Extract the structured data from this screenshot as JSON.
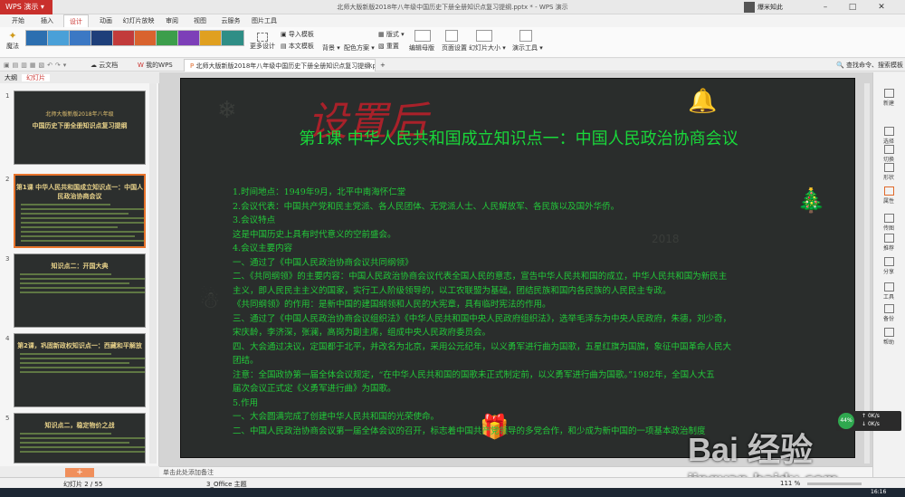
{
  "titlebar": {
    "app_name": "WPS 演示",
    "window_title": "北师大版新版2018年八年级中国历史下册全册知识点复习提纲.pptx * - WPS 演示",
    "user_name": "爆米知此"
  },
  "menu_tabs": [
    "开始",
    "插入",
    "设计",
    "动画",
    "幻灯片放映",
    "审阅",
    "视图",
    "云服务",
    "图片工具"
  ],
  "ribbon": {
    "magic": "魔法",
    "more_design": "更多设计",
    "import_template": "导入模板",
    "text_template": "本文模板",
    "background": "背景",
    "color_scheme": "配色方案",
    "layout": "版式",
    "reset": "重置",
    "edit_master": "编辑母版",
    "page_setup": "页面设置",
    "slide_size": "幻灯片大小",
    "presentation_tools": "演示工具",
    "theme_colors": [
      "#2c6fb0",
      "#4aa0d8",
      "#3b78c4",
      "#1e3f7a",
      "#c23b3b",
      "#d9632e",
      "#3c9e4b",
      "#7d3fb8",
      "#e0a020",
      "#2f8e86"
    ]
  },
  "quickbar": {
    "cloud": "云文档",
    "my_wps": "我的WPS",
    "doc_tab": "北师大版新版2018年八年级中国历史下册全册知识点复习提纲.pptx",
    "search_placeholder": "查找命令、搜索模板"
  },
  "left_panel": {
    "tab_outline": "大纲",
    "tab_slides": "幻灯片",
    "add_button": "+",
    "thumbs": [
      {
        "num": "1",
        "line1": "北师大版新版2018年八年级",
        "line2": "中国历史下册全册知识点复习提纲"
      },
      {
        "num": "2",
        "line1": "第1课 中华人民共和国成立知识点一：中国人民政治协商会议",
        "line2": ""
      },
      {
        "num": "3",
        "line1": "知识点二：开国大典",
        "line2": ""
      },
      {
        "num": "4",
        "line1": "第2课，巩固新政权知识点一：西藏和平解放",
        "line2": ""
      },
      {
        "num": "5",
        "line1": "知识点二，稳定物价之战",
        "line2": ""
      }
    ]
  },
  "slide": {
    "handwriting": "设置后",
    "title": "第1课  中华人民共和国成立知识点一：中国人民政治协商会议",
    "lines": [
      "1.时间地点：1949年9月，北平中南海怀仁堂",
      "2.会议代表：中国共产党和民主党派、各人民团体、无党派人士、人民解放军、各民族以及国外华侨。",
      "3.会议特点",
      "这是中国历史上具有时代意义的空前盛会。",
      "4.会议主要内容",
      "一、通过了《中国人民政治协商会议共同纲领》",
      "二、《共同纲领》的主要内容：中国人民政治协商会议代表全国人民的意志，宣告中华人民共和国的成立，中华人民共和国为新民主",
      "主义，即人民民主主义的国家，实行工人阶级领导的，以工农联盟为基础，团结民族和国内各民族的人民民主专政。",
      "    《共同纲领》的作用：是新中国的建国纲领和人民的大宪章，具有临时宪法的作用。",
      "三、通过了《中国人民政治协商会议组织法》《中华人民共和国中央人民政府组织法》，选举毛泽东为中央人民政府，朱德，刘少奇，",
      "宋庆龄，李济深，张澜，高岗为副主席，组成中央人民政府委员会。",
      "四、大会通过决议，定国都于北平，并改名为北京，采用公元纪年，以义勇军进行曲为国歌，五星红旗为国旗，象征中国革命人民大",
      "团结。",
      "注意：全国政协第一届全体会议规定，“在中华人民共和国的国歌未正式制定前，以义勇军进行曲为国歌。”1982年，全国人大五",
      "届次会议正式定《义勇军进行曲》为国歌。",
      "5.作用",
      "一、大会圆满完成了创建中华人民共和国的光荣使命。",
      "二、中国人民政治协商会议第一届全体会议的召开，标志着中国共产党领导的多党合作，和少成为新中国的一项基本政治制度"
    ]
  },
  "notes_placeholder": "单击此处添加备注",
  "right_tools": [
    "新建",
    "选择",
    "切换",
    "形状",
    "属性",
    "传图",
    "推荐",
    "分享",
    "工具",
    "备份",
    "帮助"
  ],
  "status": {
    "slide_index": "幻灯片 2 / 55",
    "theme": "3_Office 主题",
    "zoom": "111 %"
  },
  "network": {
    "percent": "44%",
    "up": "0K/s",
    "down": "0K/s"
  },
  "watermark": {
    "brand": "Bai 经验",
    "url": "jingyan.baidu.com"
  },
  "clock": "16:16"
}
